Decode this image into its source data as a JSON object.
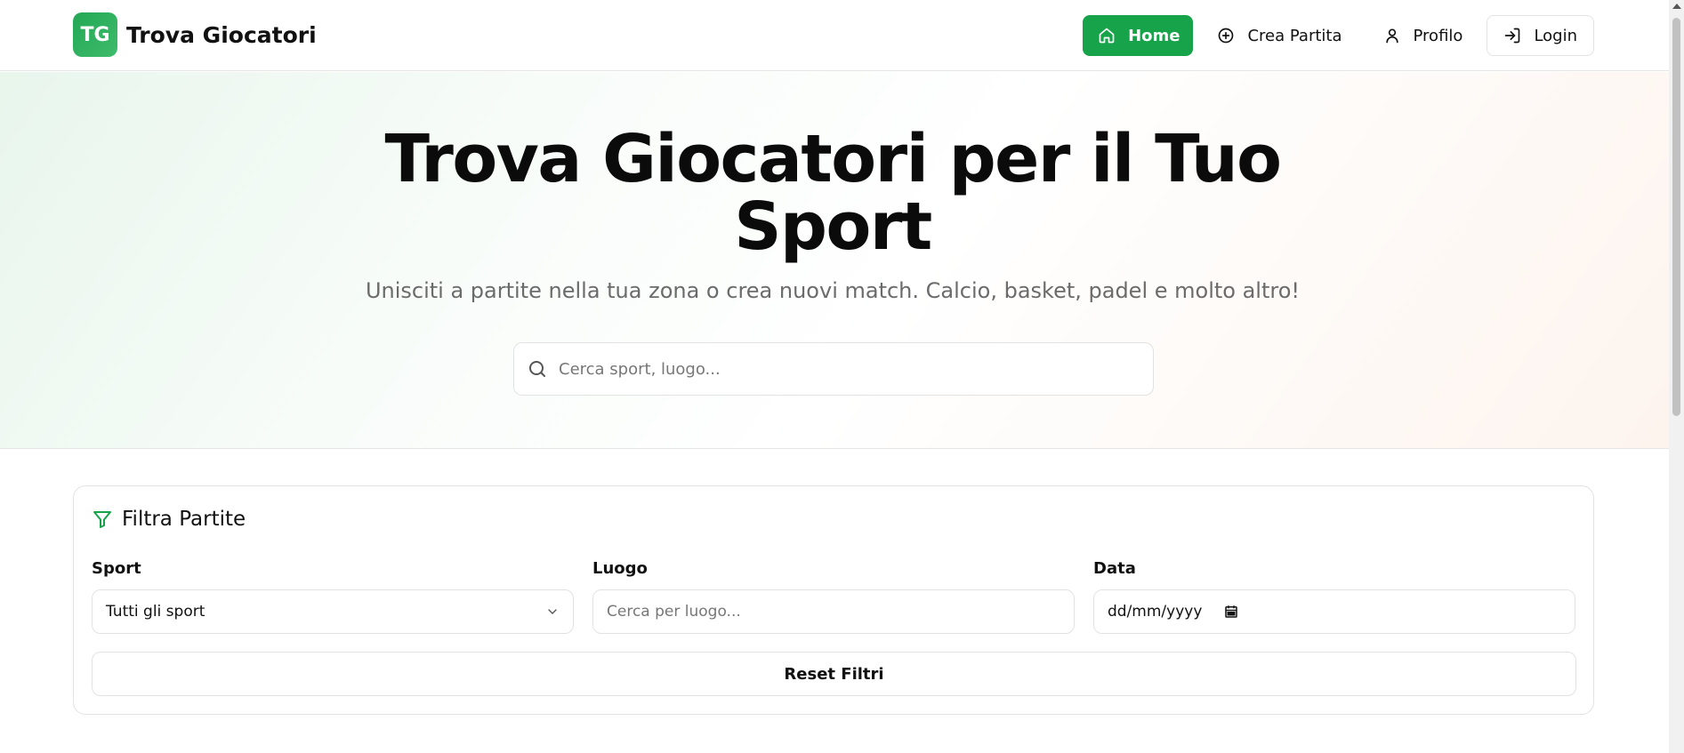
{
  "header": {
    "logo_badge": "TG",
    "logo_text": "Trova Giocatori",
    "nav": [
      {
        "label": "Home",
        "icon": "home-icon",
        "active": true
      },
      {
        "label": "Crea Partita",
        "icon": "plus-circle-icon"
      },
      {
        "label": "Profilo",
        "icon": "user-icon"
      },
      {
        "label": "Login",
        "icon": "login-icon"
      }
    ]
  },
  "hero": {
    "title_line1": "Trova Giocatori per il Tuo",
    "title_line2": "Sport",
    "subtitle": "Unisciti a partite nella tua zona o crea nuovi match. Calcio, basket, padel e molto altro!",
    "search_placeholder": "Cerca sport, luogo..."
  },
  "filters": {
    "title": "Filtra Partite",
    "sport_label": "Sport",
    "sport_value": "Tutti gli sport",
    "location_label": "Luogo",
    "location_placeholder": "Cerca per luogo...",
    "date_label": "Data",
    "date_placeholder": "dd/mm/yyyy",
    "reset_label": "Reset Filtri"
  },
  "colors": {
    "accent": "#16a34a"
  }
}
